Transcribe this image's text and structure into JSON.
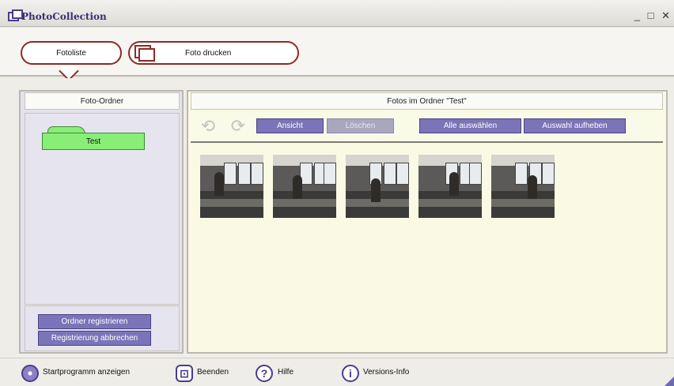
{
  "window": {
    "title": "PhotoCollection",
    "controls": "_ □ ✕"
  },
  "tabs": [
    {
      "label": "Fotoliste",
      "active": true
    },
    {
      "label": "Foto drucken",
      "active": false
    }
  ],
  "left_panel": {
    "header": "Foto-Ordner",
    "folders": [
      {
        "label": "Test",
        "selected": true
      }
    ],
    "buttons": {
      "register": "Ordner registrieren",
      "unregister": "Registrierung abbrechen"
    }
  },
  "right_panel": {
    "header": "Fotos im Ordner \"Test\"",
    "toolbar": {
      "rotate_left_icon": "rotate-left-icon",
      "rotate_right_icon": "rotate-right-icon",
      "view": "Ansicht",
      "delete": "Löschen",
      "select_all": "Alle auswählen",
      "deselect": "Auswahl aufheben"
    },
    "photo_count": 5
  },
  "bottom_bar": {
    "start": "Startprogramm anzeigen",
    "quit": "Beenden",
    "help": "Hilfe",
    "info": "Versions-Info"
  },
  "colors": {
    "accent": "#7b74b8",
    "tab_border": "#8b2b25",
    "folder_selected": "#88ee77",
    "title_text": "#3a2f74"
  }
}
